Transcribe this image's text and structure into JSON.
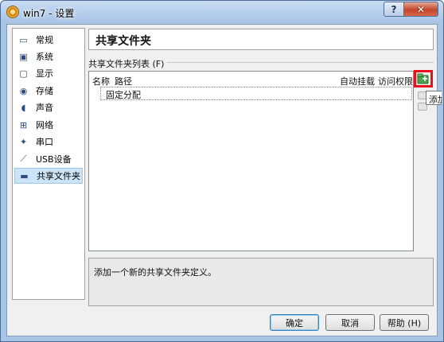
{
  "window": {
    "title": "win7 - 设置",
    "help_label": "?",
    "close_label": "✕"
  },
  "nav": {
    "items": [
      {
        "label": "常规",
        "icon": "monitor-icon",
        "glyph": "▭"
      },
      {
        "label": "系统",
        "icon": "chip-icon",
        "glyph": "▣"
      },
      {
        "label": "显示",
        "icon": "display-icon",
        "glyph": "▢"
      },
      {
        "label": "存储",
        "icon": "disk-icon",
        "glyph": "◉"
      },
      {
        "label": "声音",
        "icon": "speaker-icon",
        "glyph": "◖"
      },
      {
        "label": "网络",
        "icon": "network-icon",
        "glyph": "⊞"
      },
      {
        "label": "串口",
        "icon": "serial-port-icon",
        "glyph": "✦"
      },
      {
        "label": "USB设备",
        "icon": "usb-icon",
        "glyph": "⟋"
      },
      {
        "label": "共享文件夹",
        "icon": "shared-folder-icon",
        "glyph": "▬"
      }
    ],
    "selected_index": 8
  },
  "page": {
    "title": "共享文件夹",
    "list_label": "共享文件夹列表 (F)",
    "columns": {
      "name": "名称",
      "path": "路径",
      "auto_mount": "自动挂载",
      "access": "访问权限"
    },
    "rows": [
      {
        "name": "固定分配"
      }
    ],
    "add_tooltip": "添加",
    "description": "添加一个新的共享文件夹定义。"
  },
  "buttons": {
    "ok": "确定",
    "cancel": "取消",
    "help": "帮助 (H)"
  },
  "colors": {
    "highlight": "#e8101c",
    "selection": "#cce4f7"
  }
}
